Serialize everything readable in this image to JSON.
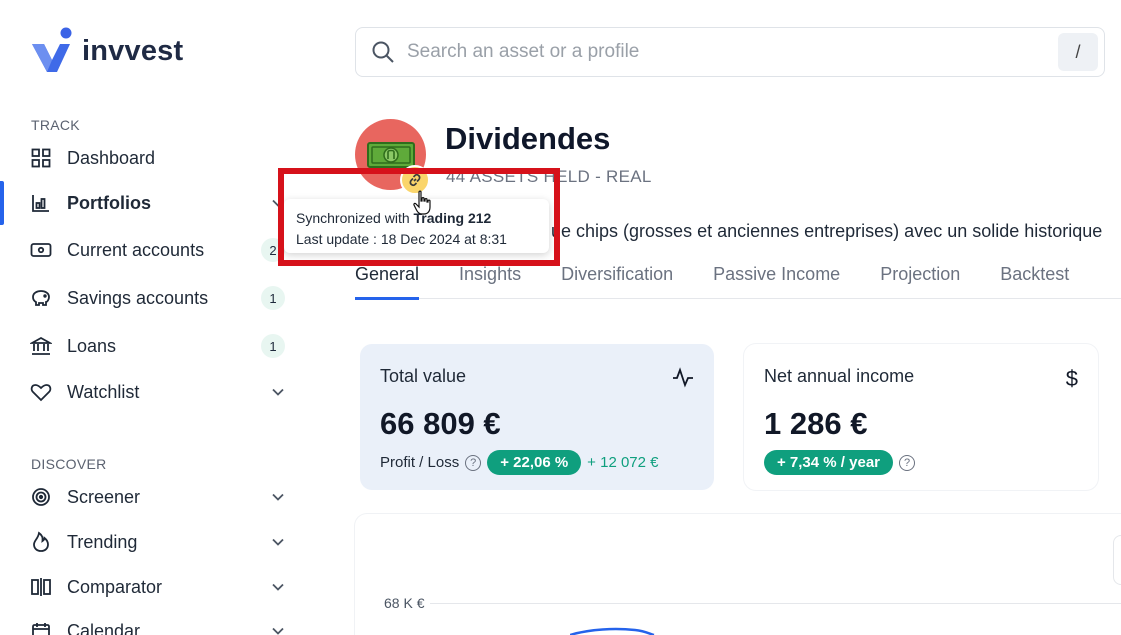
{
  "brand": {
    "name": "invvest"
  },
  "sidebar": {
    "track_label": "TRACK",
    "discover_label": "DISCOVER",
    "items": [
      {
        "label": "Dashboard",
        "icon": "dashboard-grid-icon"
      },
      {
        "label": "Portfolios",
        "icon": "bar-chart-icon",
        "active": true
      },
      {
        "label": "Current accounts",
        "icon": "wallet-icon",
        "badge": "2"
      },
      {
        "label": "Savings accounts",
        "icon": "piggy-bank-icon",
        "badge": "1"
      },
      {
        "label": "Loans",
        "icon": "bank-icon",
        "badge": "1"
      },
      {
        "label": "Watchlist",
        "icon": "heart-icon"
      }
    ],
    "discover_items": [
      {
        "label": "Screener",
        "icon": "target-icon"
      },
      {
        "label": "Trending",
        "icon": "flame-icon"
      },
      {
        "label": "Comparator",
        "icon": "compare-icon"
      },
      {
        "label": "Calendar",
        "icon": "calendar-icon"
      }
    ]
  },
  "search": {
    "placeholder": "Search an asset or a profile",
    "shortcut": "/"
  },
  "portfolio": {
    "title": "Dividendes",
    "subtitle": "44 ASSETS HELD - REAL",
    "description": "ue chips (grosses et anciennes entreprises) avec un solide historique"
  },
  "tooltip": {
    "prefix": "Synchronized with ",
    "broker": "Trading 212",
    "last_update": "Last update : 18 Dec 2024 at 8:31"
  },
  "tabs": [
    "General",
    "Insights",
    "Diversification",
    "Passive Income",
    "Projection",
    "Backtest"
  ],
  "cards": {
    "total": {
      "title": "Total value",
      "value": "66 809 €",
      "foot_label": "Profit / Loss",
      "pill": "+ 22,06 %",
      "gain": "+ 12 072 €"
    },
    "income": {
      "title": "Net annual income",
      "icon": "$",
      "value": "1 286 €",
      "pill": "+ 7,34 % / year"
    }
  },
  "chart": {
    "y_tick": "68 K €"
  },
  "colors": {
    "accent": "#2563eb",
    "positive": "#0f9f7e",
    "highlight": "#d6111a",
    "avatar": "#e8665f"
  }
}
